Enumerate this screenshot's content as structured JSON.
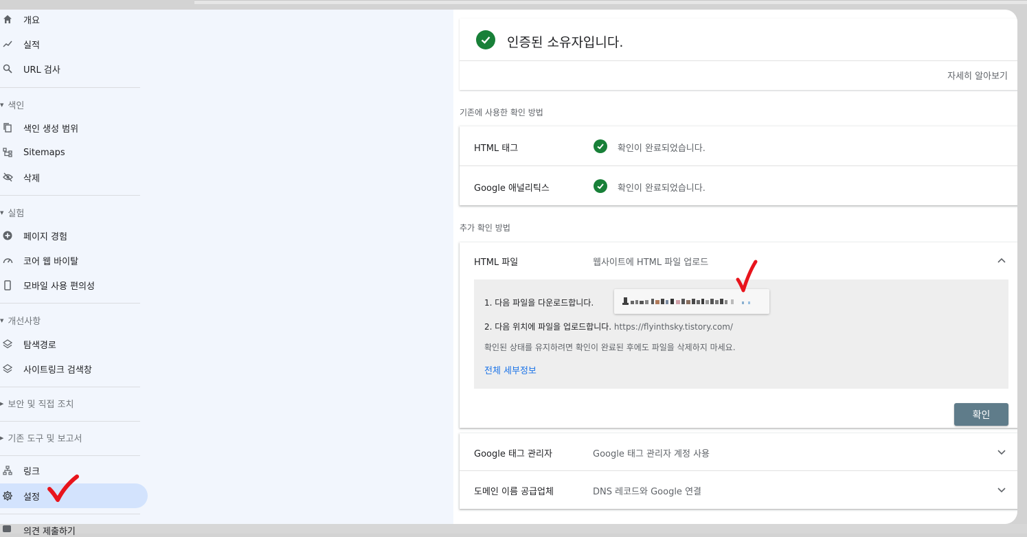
{
  "sidebar": {
    "items": [
      {
        "label": "개요"
      },
      {
        "label": "실적"
      },
      {
        "label": "URL 검사"
      }
    ],
    "index_section": "색인",
    "index_items": [
      {
        "label": "색인 생성 범위"
      },
      {
        "label": "Sitemaps"
      },
      {
        "label": "삭제"
      }
    ],
    "experience_section": "실험",
    "experience_items": [
      {
        "label": "페이지 경험"
      },
      {
        "label": "코어 웹 바이탈"
      },
      {
        "label": "모바일 사용 편의성"
      }
    ],
    "enhancements_section": "개선사항",
    "enhancements_items": [
      {
        "label": "탐색경로"
      },
      {
        "label": "사이트링크 검색창"
      }
    ],
    "security_section": "보안 및 직접 조치",
    "legacy_section": "기존 도구 및 보고서",
    "bottom_items": [
      {
        "label": "링크"
      },
      {
        "label": "설정"
      }
    ],
    "feedback_label": "의견 제출하기"
  },
  "owner_card": {
    "title": "인증된 소유자입니다.",
    "learn_more": "자세히 알아보기"
  },
  "previous_methods": {
    "title": "기존에 사용한 확인 방법",
    "rows": [
      {
        "label": "HTML 태그",
        "status": "확인이 완료되었습니다."
      },
      {
        "label": "Google 애널리틱스",
        "status": "확인이 완료되었습니다."
      }
    ]
  },
  "additional_methods": {
    "title": "추가 확인 방법",
    "html_file": {
      "label": "HTML 파일",
      "desc": "웹사이트에 HTML 파일 업로드",
      "step1": "1. 다음 파일을 다운로드합니다.",
      "step2": "2. 다음 위치에 파일을 업로드합니다.",
      "step2_url": "https://flyinthsky.tistory.com/",
      "note": "확인된 상태를 유지하려면 확인이 완료된 후에도 파일을 삭제하지 마세요.",
      "details_link": "전체 세부정보",
      "confirm_button": "확인"
    },
    "collapsed": [
      {
        "label": "Google 태그 관리자",
        "desc": "Google 태그 관리자 계정 사용"
      },
      {
        "label": "도메인 이름 공급업체",
        "desc": "DNS 레코드와 Google 연결"
      }
    ]
  },
  "colors": {
    "accent": "#1a73e8",
    "success": "#188038",
    "confirm_button": "#5f7c8a",
    "annotation": "#e8141c"
  }
}
